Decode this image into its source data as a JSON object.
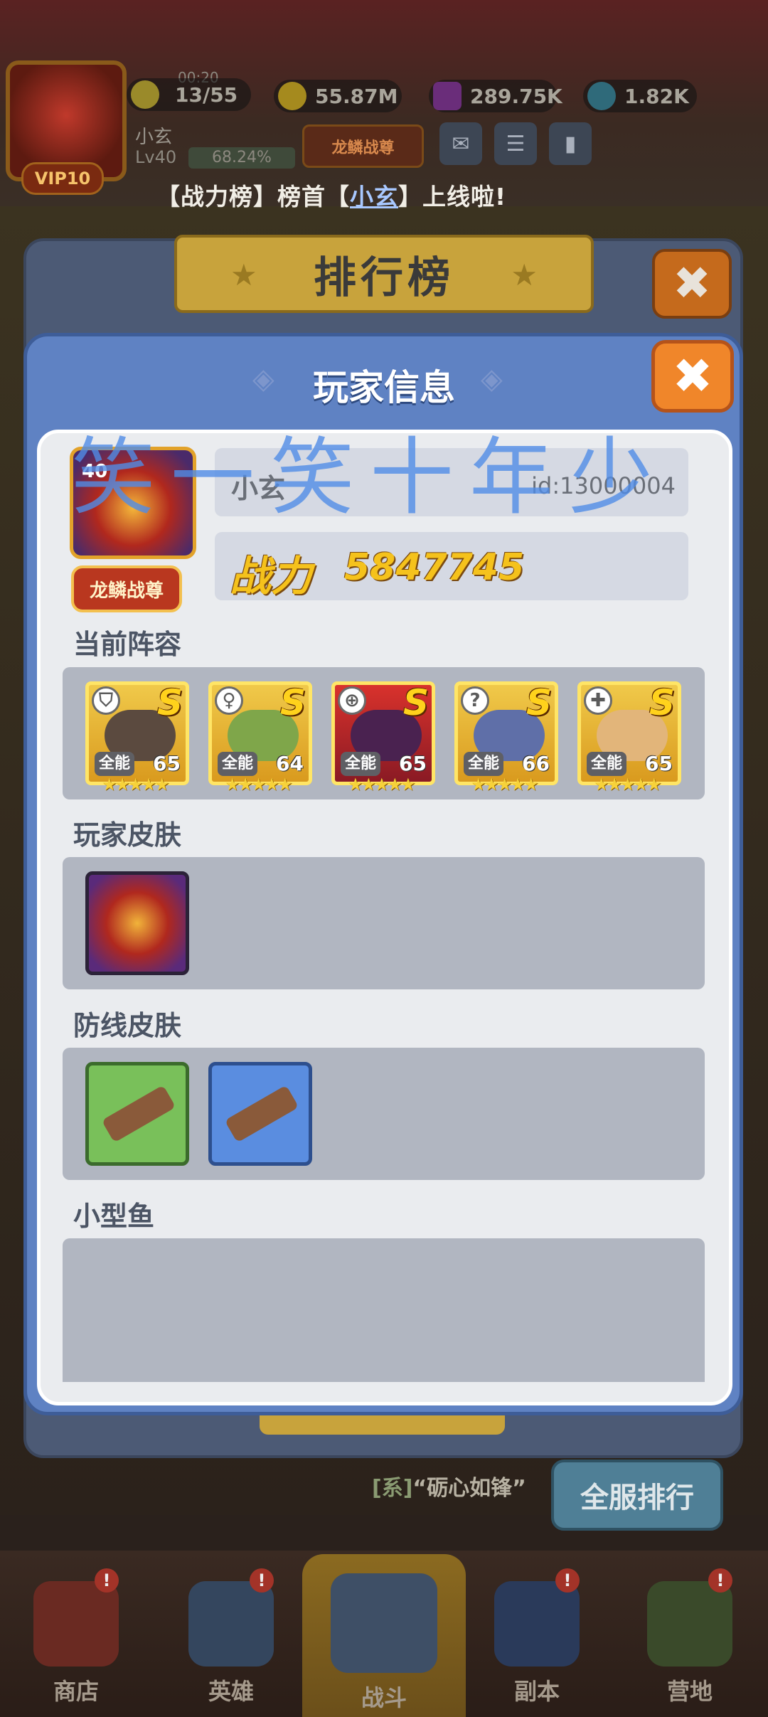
{
  "hud": {
    "stamina_timer": "00:20",
    "stamina": "13/55",
    "gold": "55.87M",
    "gems": "289.75K",
    "diamonds": "1.82K",
    "player_name": "小玄",
    "player_level": "Lv40",
    "exp_percent": "68.24%",
    "vip": "VIP10",
    "title_badge": "龙鳞战尊",
    "announcement_prefix": "【战力榜】榜首【",
    "announcement_name": "小玄",
    "announcement_suffix": "】上线啦!"
  },
  "ranking_panel": {
    "title": "排行榜",
    "close_icon": "✖",
    "chat_channel": "[系]",
    "chat_text": "“砺心如锋”",
    "server_rank_button": "全服排行"
  },
  "bottom_nav": {
    "items": [
      {
        "label": "商店",
        "badge": "!"
      },
      {
        "label": "英雄",
        "badge": "!"
      },
      {
        "label": "战斗",
        "badge": ""
      },
      {
        "label": "副本",
        "badge": "!"
      },
      {
        "label": "营地",
        "badge": "!"
      }
    ]
  },
  "player_info": {
    "title": "玩家信息",
    "close_icon": "✖",
    "watermark": "笑一笑十年少",
    "avatar_level": "40",
    "name": "小玄",
    "id": "id:13000004",
    "power_label": "战力",
    "power_value": "5847745",
    "title_badge": "龙鳞战尊",
    "sections": {
      "lineup": "当前阵容",
      "player_skin": "玩家皮肤",
      "defense_skin": "防线皮肤",
      "small_fish": "小型鱼"
    },
    "lineup": [
      {
        "grade": "S",
        "tag": "全能",
        "level": "65",
        "role": "shield-icon"
      },
      {
        "grade": "S",
        "tag": "全能",
        "level": "64",
        "role": "staff-icon"
      },
      {
        "grade": "S",
        "tag": "全能",
        "level": "65",
        "role": "bow-icon"
      },
      {
        "grade": "S",
        "tag": "全能",
        "level": "66",
        "role": "wand-icon"
      },
      {
        "grade": "S",
        "tag": "全能",
        "level": "65",
        "role": "cross-icon"
      }
    ],
    "stars": "★★★★★"
  },
  "colors": {
    "modal_blue": "#5f82c3",
    "close_orange": "#f0862a",
    "power_gold": "#f5c21c",
    "card_gold": "#ffe566"
  }
}
